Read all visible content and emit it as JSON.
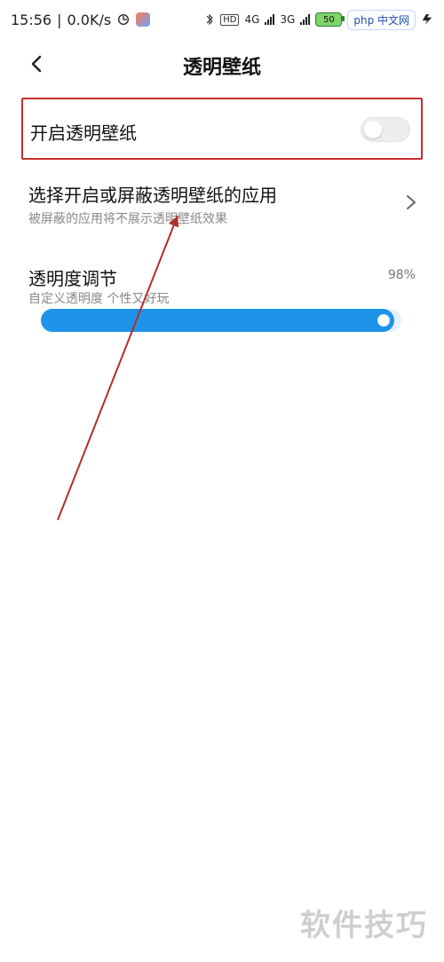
{
  "status_bar": {
    "time": "15:56",
    "separator": "|",
    "speed": "0.0K/s",
    "battery_label": "50",
    "php_badge": "php 中文网",
    "network_left": "4G",
    "network_right": "3G"
  },
  "header": {
    "title": "透明壁纸"
  },
  "toggle": {
    "label": "开启透明壁纸",
    "on": false
  },
  "select_apps": {
    "title": "选择开启或屏蔽透明壁纸的应用",
    "subtitle": "被屏蔽的应用将不展示透明壁纸效果"
  },
  "transparency": {
    "title": "透明度调节",
    "subtitle": "自定义透明度 个性又好玩",
    "value_text": "98%",
    "value_percent": 98
  },
  "watermark": "软件技巧",
  "colors": {
    "accent": "#1f93ea",
    "highlight_red": "#c92e2e"
  }
}
